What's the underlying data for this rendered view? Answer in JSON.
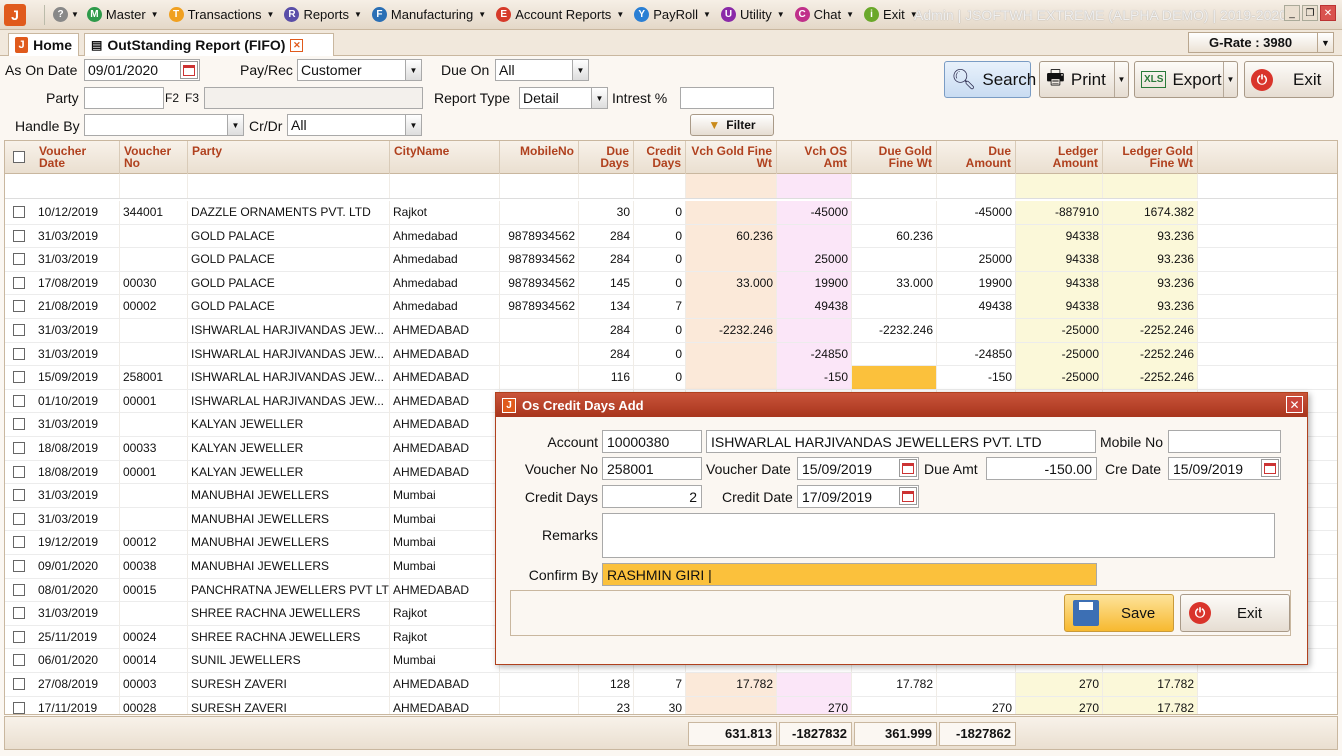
{
  "menubar": {
    "items": [
      {
        "label": "Master",
        "icon": "M",
        "color": "#2e9a4a"
      },
      {
        "label": "Transactions",
        "icon": "T",
        "color": "#f0a020"
      },
      {
        "label": "Reports",
        "icon": "R",
        "color": "#5a4ea8"
      },
      {
        "label": "Manufacturing",
        "icon": "F",
        "color": "#2a6fb5"
      },
      {
        "label": "Account Reports",
        "icon": "E",
        "color": "#d63a2a"
      },
      {
        "label": "PayRoll",
        "icon": "Y",
        "color": "#2a7fd4"
      },
      {
        "label": "Utility",
        "icon": "U",
        "color": "#8a2aa8"
      },
      {
        "label": "Chat",
        "icon": "C",
        "color": "#c0308a"
      },
      {
        "label": "Exit",
        "icon": "i",
        "color": "#6aa82a"
      }
    ],
    "title": "Admin | JSOFTWH EXTREME (ALPHA DEMO)  | 2019-2020"
  },
  "tabs": {
    "home": "Home",
    "report": "OutStanding Report (FIFO)"
  },
  "grate": "G-Rate : 3980",
  "filters": {
    "as_on_date_label": "As On Date",
    "as_on_date": "09/01/2020",
    "payrec_label": "Pay/Rec",
    "payrec": "Customer",
    "due_on_label": "Due On",
    "due_on": "All",
    "party_label": "Party",
    "f2": "F2",
    "f3": "F3",
    "report_type_label": "Report Type",
    "report_type": "Detail",
    "interest_label": "Intrest %",
    "handle_by_label": "Handle By",
    "crdr_label": "Cr/Dr",
    "crdr": "All",
    "filter_btn": "Filter"
  },
  "toolbar": {
    "search": "Search",
    "print": "Print",
    "export": "Export",
    "exit": "Exit"
  },
  "grid": {
    "headers": [
      "Voucher Date",
      "Voucher No",
      "Party",
      "CityName",
      "MobileNo",
      "Due Days",
      "Credit Days",
      "Vch Gold Fine Wt",
      "Vch OS Amt",
      "Due Gold Fine Wt",
      "Due Amount",
      "Ledger Amount",
      "Ledger Gold Fine Wt"
    ],
    "rows": [
      [
        "10/12/2019",
        "344001",
        "DAZZLE ORNAMENTS PVT. LTD",
        "Rajkot",
        "",
        "30",
        "0",
        "",
        "-45000",
        "",
        "-45000",
        "-887910",
        "1674.382"
      ],
      [
        "31/03/2019",
        "",
        "GOLD PALACE",
        "Ahmedabad",
        "9878934562",
        "284",
        "0",
        "60.236",
        "",
        "60.236",
        "",
        "94338",
        "93.236"
      ],
      [
        "31/03/2019",
        "",
        "GOLD PALACE",
        "Ahmedabad",
        "9878934562",
        "284",
        "0",
        "",
        "25000",
        "",
        "25000",
        "94338",
        "93.236"
      ],
      [
        "17/08/2019",
        "00030",
        "GOLD PALACE",
        "Ahmedabad",
        "9878934562",
        "145",
        "0",
        "33.000",
        "19900",
        "33.000",
        "19900",
        "94338",
        "93.236"
      ],
      [
        "21/08/2019",
        "00002",
        "GOLD PALACE",
        "Ahmedabad",
        "9878934562",
        "134",
        "7",
        "",
        "49438",
        "",
        "49438",
        "94338",
        "93.236"
      ],
      [
        "31/03/2019",
        "",
        "ISHWARLAL HARJIVANDAS JEW...",
        "AHMEDABAD",
        "",
        "284",
        "0",
        "-2232.246",
        "",
        "-2232.246",
        "",
        "-25000",
        "-2252.246"
      ],
      [
        "31/03/2019",
        "",
        "ISHWARLAL HARJIVANDAS JEW...",
        "AHMEDABAD",
        "",
        "284",
        "0",
        "",
        "-24850",
        "",
        "-24850",
        "-25000",
        "-2252.246"
      ],
      [
        "15/09/2019",
        "258001",
        "ISHWARLAL HARJIVANDAS JEW...",
        "AHMEDABAD",
        "",
        "116",
        "0",
        "",
        "-150",
        "",
        "-150",
        "-25000",
        "-2252.246"
      ],
      [
        "01/10/2019",
        "00001",
        "ISHWARLAL HARJIVANDAS JEW...",
        "AHMEDABAD",
        "",
        "",
        "",
        "",
        "",
        "",
        "",
        "",
        ""
      ],
      [
        "31/03/2019",
        "",
        "KALYAN JEWELLER",
        "AHMEDABAD",
        "",
        "",
        "",
        "",
        "",
        "",
        "",
        "",
        ""
      ],
      [
        "18/08/2019",
        "00033",
        "KALYAN JEWELLER",
        "AHMEDABAD",
        "",
        "",
        "",
        "",
        "",
        "",
        "",
        "",
        ""
      ],
      [
        "18/08/2019",
        "00001",
        "KALYAN JEWELLER",
        "AHMEDABAD",
        "",
        "",
        "",
        "",
        "",
        "",
        "",
        "",
        ""
      ],
      [
        "31/03/2019",
        "",
        "MANUBHAI JEWELLERS",
        "Mumbai",
        "",
        "",
        "",
        "",
        "",
        "",
        "",
        "",
        ""
      ],
      [
        "31/03/2019",
        "",
        "MANUBHAI JEWELLERS",
        "Mumbai",
        "",
        "",
        "",
        "",
        "",
        "",
        "",
        "",
        ""
      ],
      [
        "19/12/2019",
        "00012",
        "MANUBHAI JEWELLERS",
        "Mumbai",
        "",
        "",
        "",
        "",
        "",
        "",
        "",
        "",
        ""
      ],
      [
        "09/01/2020",
        "00038",
        "MANUBHAI JEWELLERS",
        "Mumbai",
        "",
        "",
        "",
        "",
        "",
        "",
        "",
        "",
        ""
      ],
      [
        "08/01/2020",
        "00015",
        "PANCHRATNA JEWELLERS PVT LTD",
        "AHMEDABAD",
        "",
        "",
        "",
        "",
        "",
        "",
        "",
        "",
        ""
      ],
      [
        "31/03/2019",
        "",
        "SHREE RACHNA JEWELLERS",
        "Rajkot",
        "",
        "",
        "",
        "",
        "",
        "",
        "",
        "",
        ""
      ],
      [
        "25/11/2019",
        "00024",
        "SHREE RACHNA JEWELLERS",
        "Rajkot",
        "",
        "",
        "",
        "",
        "",
        "",
        "",
        "",
        ""
      ],
      [
        "06/01/2020",
        "00014",
        "SUNIL JEWELLERS",
        "Mumbai",
        "",
        "",
        "",
        "",
        "",
        "",
        "",
        "",
        ""
      ],
      [
        "27/08/2019",
        "00003",
        "SURESH ZAVERI",
        "AHMEDABAD",
        "",
        "128",
        "7",
        "17.782",
        "",
        "17.782",
        "",
        "270",
        "17.782"
      ],
      [
        "17/11/2019",
        "00028",
        "SURESH ZAVERI",
        "AHMEDABAD",
        "",
        "23",
        "30",
        "",
        "270",
        "",
        "270",
        "270",
        "17.782"
      ]
    ],
    "totals": [
      "631.813",
      "-1827832",
      "361.999",
      "-1827862"
    ]
  },
  "dialog": {
    "title": "Os Credit Days Add",
    "account_label": "Account",
    "account": "10000380",
    "account_name": "ISHWARLAL HARJIVANDAS JEWELLERS PVT. LTD",
    "mobile_label": "Mobile No",
    "mobile": "",
    "voucher_no_label": "Voucher No",
    "voucher_no": "258001",
    "voucher_date_label": "Voucher Date",
    "voucher_date": "15/09/2019",
    "due_amt_label": "Due Amt",
    "due_amt": "-150.00",
    "cre_date_label": "Cre Date",
    "cre_date": "15/09/2019",
    "credit_days_label": "Credit Days",
    "credit_days": "2",
    "credit_date_label": "Credit Date",
    "credit_date": "17/09/2019",
    "remarks_label": "Remarks",
    "remarks": "",
    "confirm_label": "Confirm By",
    "confirm": "RASHMIN GIRI |",
    "save": "Save",
    "exit": "Exit"
  }
}
